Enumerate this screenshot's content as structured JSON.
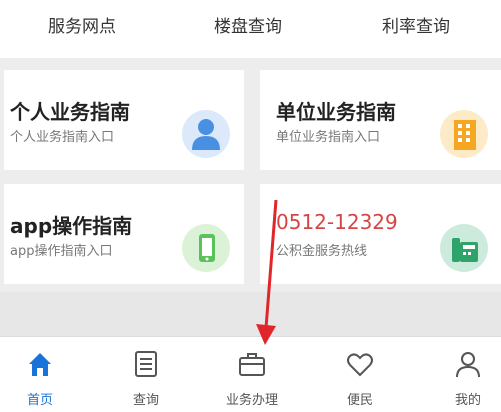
{
  "shortcuts": [
    "服务网点",
    "楼盘查询",
    "利率查询"
  ],
  "cards": [
    {
      "title": "个人业务指南",
      "subtitle": "个人业务指南入口",
      "icon": "person-icon"
    },
    {
      "title": "单位业务指南",
      "subtitle": "单位业务指南入口",
      "icon": "building-icon"
    },
    {
      "title": "app操作指南",
      "subtitle": "app操作指南入口",
      "icon": "phone-icon"
    },
    {
      "title": "0512-12329",
      "subtitle": "公积金服务热线",
      "icon": "hotline-icon"
    }
  ],
  "tabs": [
    {
      "label": "首页",
      "icon": "home-icon"
    },
    {
      "label": "查询",
      "icon": "document-icon"
    },
    {
      "label": "业务办理",
      "icon": "briefcase-icon"
    },
    {
      "label": "便民",
      "icon": "heart-icon"
    },
    {
      "label": "我的",
      "icon": "user-icon"
    }
  ],
  "colors": {
    "accent": "#1a73d9",
    "hotline_red": "#d64545",
    "building_orange": "#f5a623",
    "person_blue": "#4a90e2",
    "phone_green": "#59c25c",
    "hotline_green": "#2ea36a",
    "arrow_red": "#e0262a"
  }
}
